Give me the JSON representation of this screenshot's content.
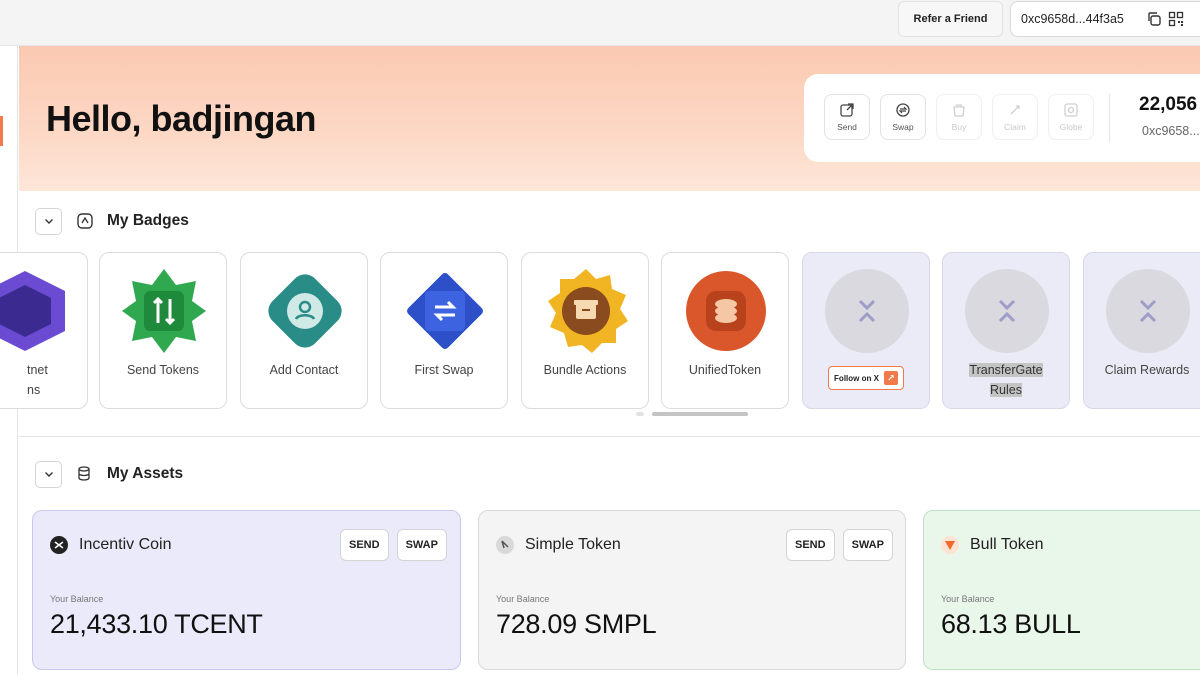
{
  "topbar": {
    "refer_label": "Refer a Friend",
    "wallet_address": "0xc9658d...44f3a5"
  },
  "hero": {
    "greeting": "Hello, badjingan",
    "actions": [
      {
        "label": "Send",
        "icon": "send-icon",
        "enabled": true
      },
      {
        "label": "Swap",
        "icon": "swap-icon",
        "enabled": true
      },
      {
        "label": "Buy",
        "icon": "buy-icon",
        "enabled": false
      },
      {
        "label": "Claim",
        "icon": "claim-icon",
        "enabled": false
      },
      {
        "label": "Globe",
        "icon": "globe-icon",
        "enabled": false
      }
    ],
    "balance": "22,056",
    "address": "0xc9658..."
  },
  "badges_section": {
    "title": "My Badges",
    "badges": [
      {
        "label_line1": "tnet",
        "label_line2": "ns",
        "emblem": "purple-badge",
        "locked": false
      },
      {
        "label_line1": "Send Tokens",
        "label_line2": "",
        "emblem": "green-star-badge",
        "locked": false
      },
      {
        "label_line1": "Add Contact",
        "label_line2": "",
        "emblem": "teal-user-badge",
        "locked": false
      },
      {
        "label_line1": "First Swap",
        "label_line2": "",
        "emblem": "blue-swap-badge",
        "locked": false
      },
      {
        "label_line1": "Bundle Actions",
        "label_line2": "",
        "emblem": "gold-box-badge",
        "locked": false
      },
      {
        "label_line1": "UnifiedToken",
        "label_line2": "",
        "emblem": "orange-coins-badge",
        "locked": false
      },
      {
        "label_line1": "",
        "label_line2": "",
        "emblem": "locked-badge",
        "locked": true,
        "follow_label": "Follow on X"
      },
      {
        "label_line1": "TransferGate",
        "label_line2": "Rules",
        "emblem": "locked-badge",
        "locked": true
      },
      {
        "label_line1": "Claim Rewards",
        "label_line2": "",
        "emblem": "locked-badge",
        "locked": true
      }
    ]
  },
  "assets_section": {
    "title": "My Assets",
    "balance_label": "Your Balance",
    "send_label": "SEND",
    "swap_label": "SWAP",
    "assets": [
      {
        "name": "Incentiv Coin",
        "balance": "21,433.10 TCENT",
        "logo": "incentiv-logo-icon",
        "bg": "#eaeafa",
        "border": "#c8c8ec"
      },
      {
        "name": "Simple Token",
        "balance": "728.09 SMPL",
        "logo": "simple-token-logo-icon",
        "bg": "#f4f4f4",
        "border": "#dadada"
      },
      {
        "name": "Bull Token",
        "balance": "68.13 BULL",
        "logo": "bull-token-logo-icon",
        "bg": "#e9f6ea",
        "border": "#bfe0c3"
      }
    ]
  },
  "colors": {
    "accent": "#f07a4a",
    "hero_bg": "#fbc9b1"
  }
}
